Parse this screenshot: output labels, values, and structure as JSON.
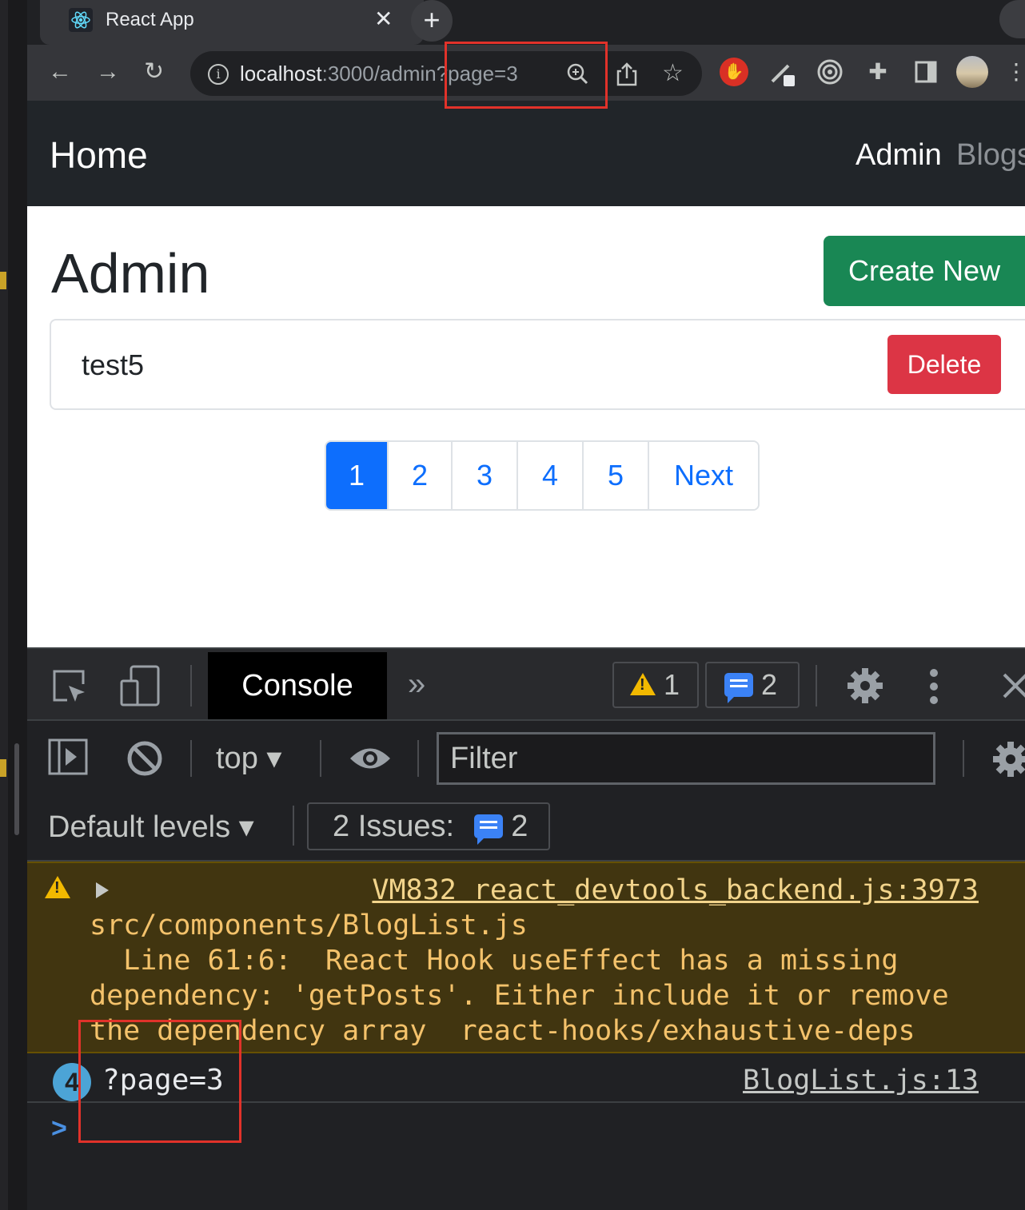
{
  "browser": {
    "tab_title": "React App",
    "tab_close": "✕",
    "new_tab": "+",
    "url_host": "localhost",
    "url_path": ":3000/admin?page=3",
    "back": "←",
    "forward": "→",
    "reload": "↻"
  },
  "navbar": {
    "brand": "Home",
    "links": [
      "Admin",
      "Blogs"
    ]
  },
  "page": {
    "heading": "Admin",
    "create_button": "Create New",
    "items": [
      {
        "title": "test5",
        "delete_label": "Delete"
      }
    ],
    "pagination": {
      "pages": [
        "1",
        "2",
        "3",
        "4",
        "5"
      ],
      "active_page": "1",
      "next_label": "Next"
    }
  },
  "devtools": {
    "active_tab": "Console",
    "more_tabs": "»",
    "warning_count": "1",
    "message_count": "2",
    "context": "top",
    "filter_placeholder": "Filter",
    "levels": "Default levels",
    "issues_label": "2 Issues:",
    "issues_count": "2",
    "warning": {
      "source": "VM832 react_devtools_backend.js:3973",
      "text": "src/components/BlogList.js\n  Line 61:6:  React Hook useEffect has a missing dependency: 'getPosts'. Either include it or remove the dependency array  react-hooks/exhaustive-deps"
    },
    "log": {
      "repeat_count": "4",
      "value": "?page=3",
      "source": "BlogList.js:13"
    },
    "prompt": ">"
  },
  "colors": {
    "highlight": "#e1322a",
    "primary": "#0d6efd",
    "success": "#198754",
    "danger": "#dc3545"
  }
}
